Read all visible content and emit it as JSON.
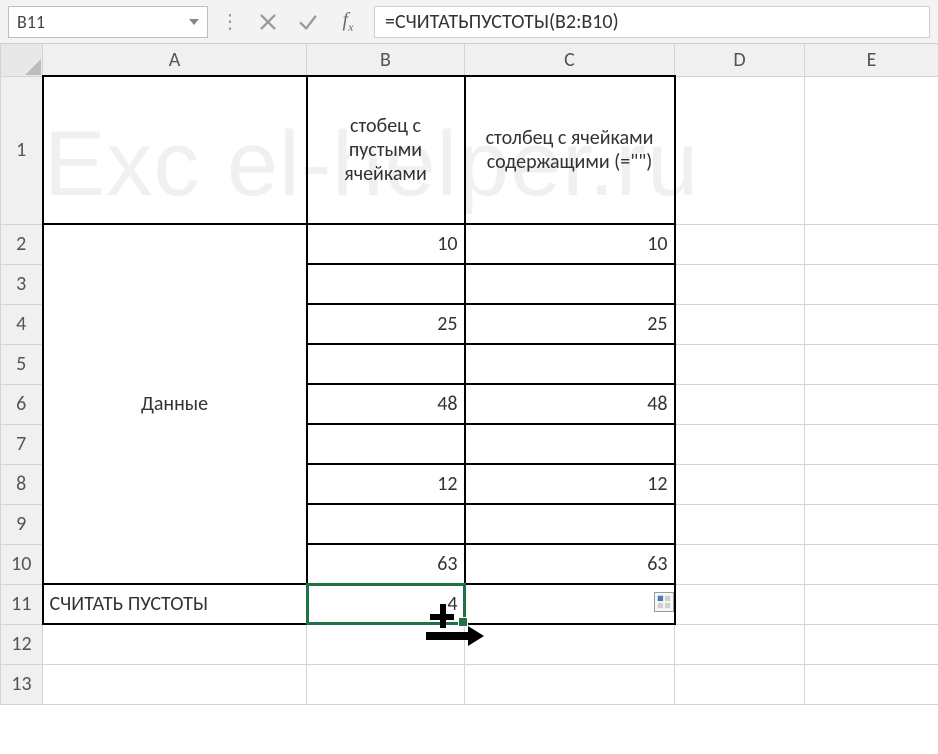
{
  "nameBox": {
    "value": "B11"
  },
  "formulaBar": {
    "formula": "=СЧИТАТЬПУСТОТЫ(B2:B10)"
  },
  "columns": [
    "A",
    "B",
    "C",
    "D",
    "E"
  ],
  "rowNumbers": [
    "1",
    "2",
    "3",
    "4",
    "5",
    "6",
    "7",
    "8",
    "9",
    "10",
    "11",
    "12",
    "13"
  ],
  "headers": {
    "B1": "стобец с пустыми ячейками",
    "C1": "столбец с ячейками содержащими (=\"\")"
  },
  "dataLabel": "Данные",
  "resultLabel": "СЧИТАТЬ ПУСТОТЫ",
  "cells": {
    "B2": "10",
    "C2": "10",
    "B4": "25",
    "C4": "25",
    "B6": "48",
    "C6": "48",
    "B8": "12",
    "C8": "12",
    "B10": "63",
    "C10": "63",
    "B11": "4"
  },
  "watermark": "Exc el-helper.ru",
  "icons": {
    "cancel": "cancel-icon",
    "confirm": "confirm-icon",
    "fx": "fx-icon",
    "dropdown": "dropdown-icon",
    "pasteHint": "autofill-options-icon"
  },
  "chart_data": {
    "type": "table",
    "title": "",
    "columns": [
      "Данные (A)",
      "стобец с пустыми ячейками (B)",
      "столбец с ячейками содержащими (=\"\") (C)"
    ],
    "rows": [
      [
        "",
        10,
        10
      ],
      [
        "",
        null,
        null
      ],
      [
        "",
        25,
        25
      ],
      [
        "",
        null,
        null
      ],
      [
        "",
        48,
        48
      ],
      [
        "",
        null,
        null
      ],
      [
        "",
        12,
        12
      ],
      [
        "",
        null,
        null
      ],
      [
        "",
        63,
        63
      ]
    ],
    "summary": {
      "label": "СЧИТАТЬ ПУСТОТЫ",
      "B": 4
    }
  }
}
